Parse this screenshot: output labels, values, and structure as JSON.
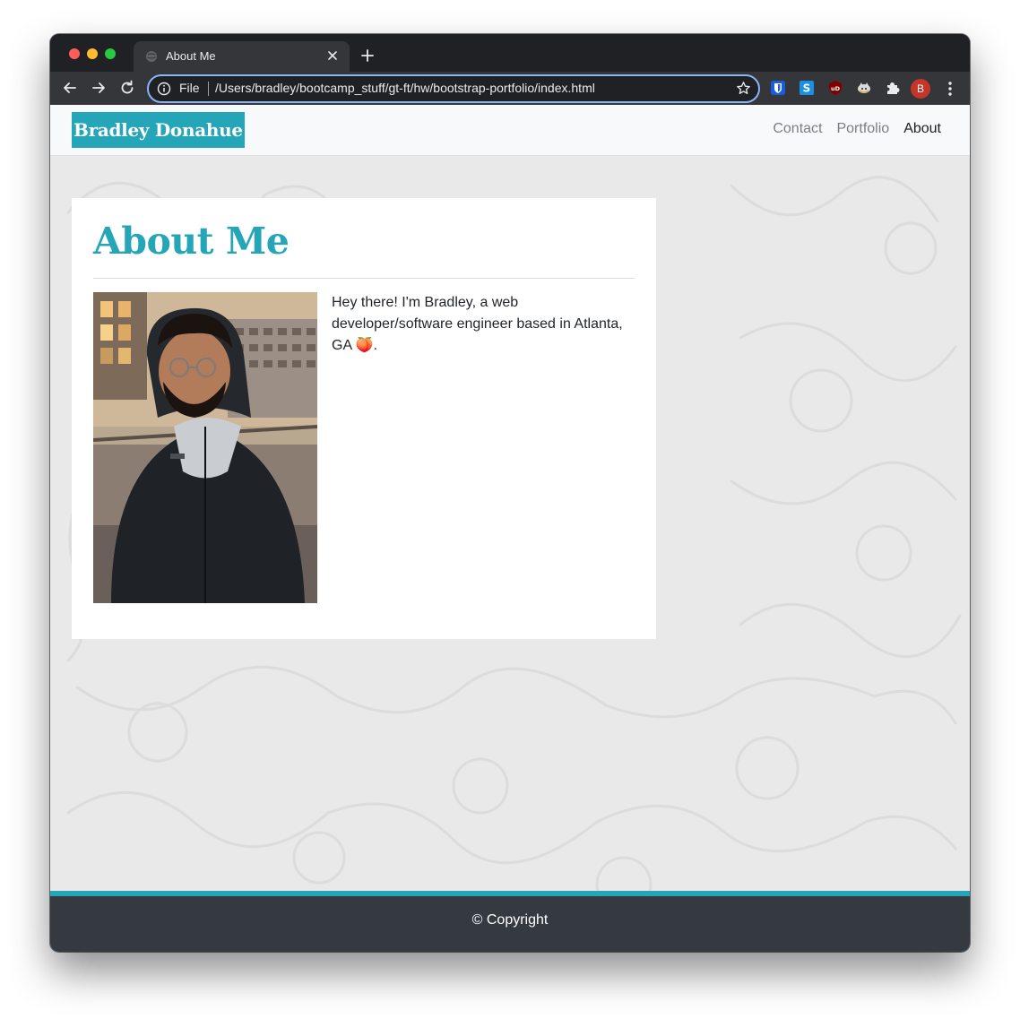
{
  "browser": {
    "tab_title": "About Me",
    "omnibox_scheme_label": "File",
    "url": "/Users/bradley/bootcamp_stuff/gt-ft/hw/bootstrap-portfolio/index.html",
    "profile_initial": "B"
  },
  "site": {
    "brand": "Bradley Donahue",
    "nav": [
      {
        "label": "Contact"
      },
      {
        "label": "Portfolio"
      },
      {
        "label": "About"
      }
    ]
  },
  "about": {
    "heading": "About Me",
    "bio": "Hey there! I'm Bradley, a web developer/software engineer based in Atlanta, GA 🍑."
  },
  "footer": {
    "text": "© Copyright"
  },
  "colors": {
    "accent": "#24a5b8",
    "footer_bg": "#343a40",
    "page_bg": "#e9e9e9"
  }
}
